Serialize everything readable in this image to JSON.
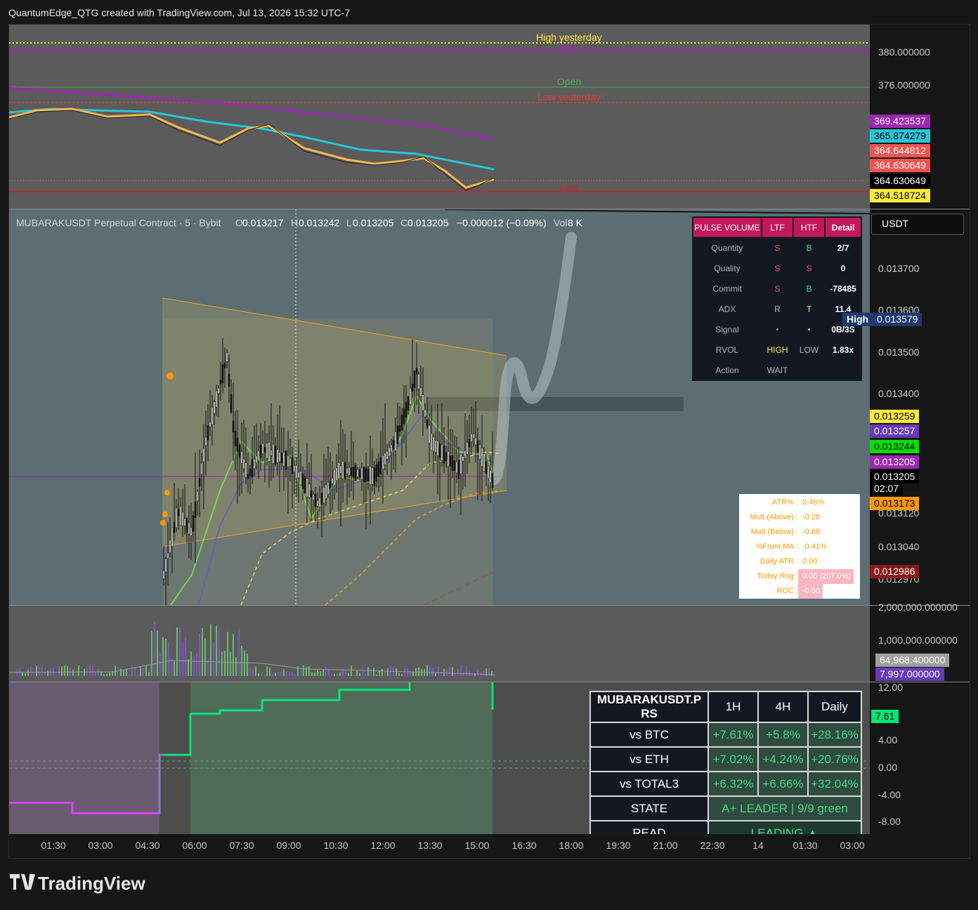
{
  "header": {
    "credit": "QuantumEdge_QTG created with TradingView.com, Jul 13, 2026 15:32 UTC-7"
  },
  "top_pane": {
    "levels": [
      {
        "label": "High yesterday",
        "color": "#ffeb3b",
        "style": "dotted"
      },
      {
        "label": "High",
        "color": "#9c27b0",
        "style": "solid"
      },
      {
        "label": "Open",
        "color": "#4caf50",
        "style": "solid"
      },
      {
        "label": "Low yesterday",
        "color": "#e53935",
        "style": "dashed"
      },
      {
        "label": "Low",
        "color": "#c62828",
        "style": "solid"
      }
    ],
    "axis_ticks": [
      "380.000000",
      "376.000000"
    ],
    "tags": [
      {
        "text": "369.423537",
        "bg": "#9c27b0",
        "fg": "#ffffff"
      },
      {
        "text": "365.874279",
        "bg": "#26c6da",
        "fg": "#000000"
      },
      {
        "text": "364.644812",
        "bg": "#ef5350",
        "fg": "#ffffff"
      },
      {
        "text": "364.630649",
        "bg": "#ef5350",
        "fg": "#ffffff"
      },
      {
        "text": "364.630649",
        "bg": "#000000",
        "fg": "#ffffff"
      },
      {
        "text": "364.518724",
        "bg": "#ffeb3b",
        "fg": "#000000"
      }
    ]
  },
  "main_pane": {
    "legend": {
      "symbol": "MUBARAKUSDT Perpetual Contract · 5 · Bybit",
      "o_label": "O",
      "o": "0.013217",
      "h_label": "H",
      "h": "0.013242",
      "l_label": "L",
      "l": "0.013205",
      "c_label": "C",
      "c": "0.013205",
      "change": "−0.000012 (−0.09%)",
      "vol_label": "Vol",
      "vol": "8 K"
    },
    "currency": "USDT",
    "axis_ticks": [
      "0.013700",
      "0.013600",
      "0.013500",
      "0.013400",
      "0.013120",
      "0.013040",
      "0.012970"
    ],
    "high_label": "High",
    "tags": [
      {
        "text": "0.013579",
        "bg": "#1e3a6e",
        "fg": "#ffffff"
      },
      {
        "text": "0.013259",
        "bg": "#ffeb3b",
        "fg": "#000000"
      },
      {
        "text": "0.013257",
        "bg": "#673ab7",
        "fg": "#ffffff"
      },
      {
        "text": "0.013244",
        "bg": "#00e000",
        "fg": "#000000"
      },
      {
        "text": "0.013205",
        "bg": "#9c27b0",
        "fg": "#ffffff"
      },
      {
        "text": "0.013205",
        "bg": "#000000",
        "fg": "#ffffff"
      },
      {
        "text": "02:07",
        "bg": "#000000",
        "fg": "#ffffff"
      },
      {
        "text": "0.013173",
        "bg": "#ff9800",
        "fg": "#000000"
      },
      {
        "text": "0.012986",
        "bg": "#8b1a1a",
        "fg": "#ffffff"
      }
    ],
    "pulse_volume": {
      "headers": [
        "PULSE VOLUME",
        "LTF",
        "HTF",
        "Detail"
      ],
      "rows": [
        {
          "k": "Quantity",
          "ltf": "S",
          "htf": "B",
          "d": "2/7",
          "lc": "#ef5350",
          "hc": "#3ddc84"
        },
        {
          "k": "Quality",
          "ltf": "S",
          "htf": "S",
          "d": "0",
          "lc": "#ef5350",
          "hc": "#ef5350"
        },
        {
          "k": "Commit",
          "ltf": "S",
          "htf": "B",
          "d": "-78485",
          "lc": "#ef5350",
          "hc": "#3ddc84"
        },
        {
          "k": "ADX",
          "ltf": "R",
          "htf": "T",
          "d": "11.4",
          "lc": "#b0b3bb",
          "hc": "#ffeb3b"
        },
        {
          "k": "Signal",
          "ltf": "•",
          "htf": "•",
          "d": "0B/3S",
          "lc": "#ef5350",
          "hc": "#b0b3bb"
        },
        {
          "k": "RVOL",
          "ltf": "HIGH",
          "htf": "LOW",
          "d": "1.83x",
          "lc": "#ffeb3b",
          "hc": "#b0b3bb"
        },
        {
          "k": "Action",
          "ltf": "WAIT",
          "htf": "",
          "d": "",
          "lc": "#b0b3bb",
          "hc": "#b0b3bb"
        }
      ]
    },
    "atr_box": [
      {
        "k": "ATR% :",
        "v": "0.46%"
      },
      {
        "k": "Mult (Above) :",
        "v": "-0.28"
      },
      {
        "k": "Mult (Below) :",
        "v": "-0.89"
      },
      {
        "k": "%From MA :",
        "v": "-0.41%"
      },
      {
        "k": "Daily ATR :",
        "v": "0.00"
      },
      {
        "k": "Today Rng :",
        "v": "0.00 (207.0%)"
      },
      {
        "k": "ROC :",
        "v": "-0.50"
      }
    ]
  },
  "volume_pane": {
    "axis_ticks": [
      "2,000,000.000000",
      "1,000,000.000000"
    ],
    "tags": [
      {
        "text": "64,968.400000",
        "bg": "#9e9e9e",
        "fg": "#ffffff"
      },
      {
        "text": "7,997.000000",
        "bg": "#673ab7",
        "fg": "#ffffff"
      }
    ]
  },
  "rs_pane": {
    "axis_ticks": [
      "12.00",
      "4.00",
      "0.00",
      "-4.00",
      "-8.00"
    ],
    "tag": {
      "text": "7.61",
      "bg": "#00e676",
      "fg": "#000000"
    },
    "table": {
      "title": "MUBARAKUSDT.P RS",
      "cols": [
        "1H",
        "4H",
        "Daily"
      ],
      "rows": [
        {
          "label": "vs BTC",
          "vals": [
            "+7.61%",
            "+5.8%",
            "+28.16%"
          ]
        },
        {
          "label": "vs ETH",
          "vals": [
            "+7.02%",
            "+4.24%",
            "+20.76%"
          ]
        },
        {
          "label": "vs TOTAL3",
          "vals": [
            "+6.32%",
            "+6.66%",
            "+32.04%"
          ]
        }
      ],
      "state_label": "STATE",
      "state": "A+ LEADER | 9/9 green",
      "read_label": "READ",
      "read": "LEADING ▲"
    }
  },
  "time_axis": [
    "01:30",
    "03:00",
    "04:30",
    "06:00",
    "07:30",
    "09:00",
    "10:30",
    "12:00",
    "13:30",
    "15:00",
    "16:30",
    "18:00",
    "19:30",
    "21:00",
    "22:30",
    "14",
    "01:30",
    "03:00"
  ],
  "logo": "TradingView",
  "chart_data": {
    "type": "line",
    "title": "MUBARAKUSDT Perpetual Contract · 5 · Bybit",
    "x": [
      "01:30",
      "03:00",
      "04:30",
      "06:00",
      "07:30",
      "09:00",
      "10:30",
      "12:00",
      "13:30",
      "15:00"
    ],
    "series": [
      {
        "values": [
          null,
          null,
          null,
          0.01296,
          0.01334,
          0.01324,
          0.01322,
          0.0133,
          0.01342,
          0.013205
        ]
      },
      {
        "name": "vs BTC",
        "values": [
          -6.0,
          -7.5,
          -7.5,
          1.0,
          7.0,
          7.5,
          9.0,
          10.5,
          12.0,
          7.61
        ]
      }
    ],
    "ylim": [
      0.01297,
      0.01372
    ],
    "tags": {
      "last": "0.013205",
      "high": "0.013579"
    }
  }
}
